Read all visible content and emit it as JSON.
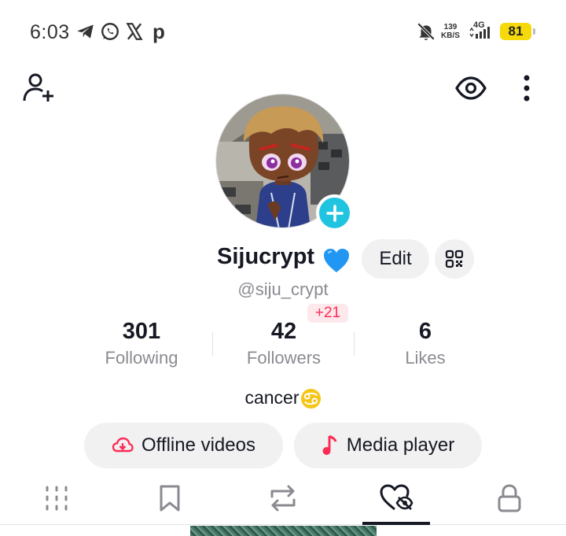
{
  "status_bar": {
    "time": "6:03",
    "app_icons": [
      "telegram-icon",
      "whatsapp-icon",
      "x-icon",
      "p-icon"
    ],
    "p_letter": "p",
    "speed_value": "139",
    "speed_unit": "KB/S",
    "network": "4G",
    "battery": "81"
  },
  "top_bar": {
    "add_friend_icon": "person-add-icon",
    "profile_views_icon": "eye-icon",
    "menu_icon": "more-vertical-icon"
  },
  "profile": {
    "username": "Sijucrypt",
    "username_emoji": "blue-heart",
    "handle": "@siju_crypt",
    "edit_label": "Edit",
    "followers_new_badge": "+21",
    "bio_text": "cancer",
    "bio_emoji": "cancer-zodiac"
  },
  "stats": [
    {
      "value": "301",
      "label": "Following"
    },
    {
      "value": "42",
      "label": "Followers"
    },
    {
      "value": "6",
      "label": "Likes"
    }
  ],
  "actions": {
    "offline_label": "Offline videos",
    "media_label": "Media player"
  },
  "tabs": [
    {
      "icon": "grid-icon",
      "active": false
    },
    {
      "icon": "bookmark-icon",
      "active": false
    },
    {
      "icon": "repost-icon",
      "active": false
    },
    {
      "icon": "liked-hidden-icon",
      "active": true
    },
    {
      "icon": "lock-icon",
      "active": false
    }
  ],
  "colors": {
    "accent_cyan": "#21c4e0",
    "accent_red": "#fe2c55",
    "battery": "#f5d90a",
    "text_primary": "#161823",
    "text_secondary": "#8a8b91",
    "pill_bg": "#f1f1f2"
  }
}
